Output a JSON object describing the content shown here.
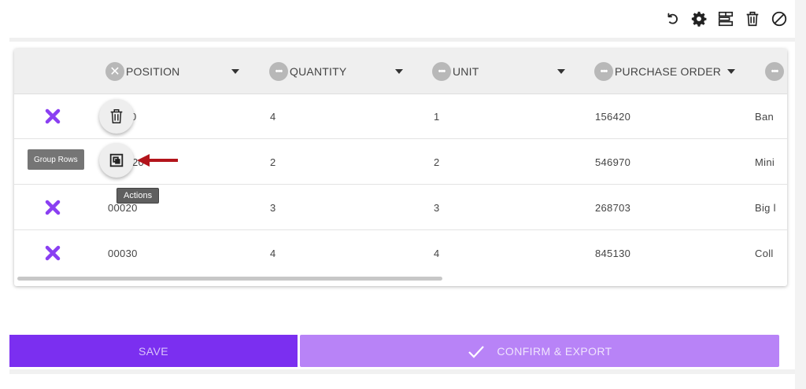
{
  "toolbar": {
    "icons": [
      "undo-icon",
      "gear-icon",
      "group-columns-icon",
      "trash-icon",
      "block-icon"
    ]
  },
  "table": {
    "columns": [
      {
        "label": "POSITION",
        "menu_icon": "close-icon"
      },
      {
        "label": "QUANTITY",
        "menu_icon": "more-icon"
      },
      {
        "label": "UNIT",
        "menu_icon": "more-icon"
      },
      {
        "label": "PURCHASE ORDER",
        "menu_icon": "more-icon"
      },
      {
        "label": "",
        "menu_icon": "more-icon"
      }
    ],
    "rows": [
      {
        "position": "0",
        "quantity": "4",
        "unit": "1",
        "purchase_order": "156420",
        "extra": "Ban"
      },
      {
        "position": "20",
        "quantity": "2",
        "unit": "2",
        "purchase_order": "546970",
        "extra": "Mini"
      },
      {
        "position": "00020",
        "quantity": "3",
        "unit": "3",
        "purchase_order": "268703",
        "extra": "Big l"
      },
      {
        "position": "00030",
        "quantity": "4",
        "unit": "4",
        "purchase_order": "845130",
        "extra": "Coll"
      }
    ]
  },
  "overlay": {
    "group_rows_tooltip": "Group Rows",
    "actions_tooltip": "Actions"
  },
  "footer": {
    "save_label": "SAVE",
    "confirm_label": "CONFIRM & EXPORT"
  },
  "colors": {
    "accent": "#7b2ff0",
    "accent_light": "#b883f7",
    "delete_x": "#8a3ff2",
    "arrow": "#b3141b"
  }
}
